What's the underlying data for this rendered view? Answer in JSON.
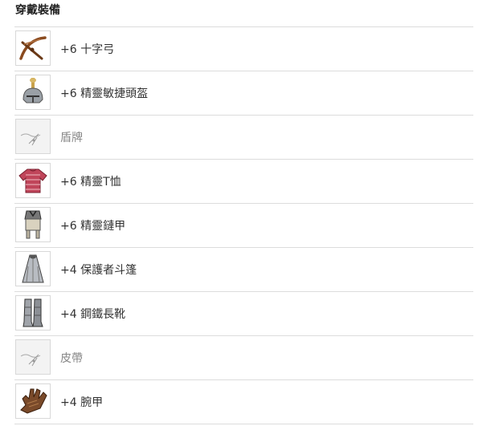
{
  "section": {
    "title": "穿戴裝備"
  },
  "items": [
    {
      "label": "+6 十字弓",
      "icon": "crossbow-icon",
      "empty": false
    },
    {
      "label": "+6 精靈敏捷頭盔",
      "icon": "helmet-icon",
      "empty": false
    },
    {
      "label": "盾牌",
      "icon": "empty-slot-icon",
      "empty": true
    },
    {
      "label": "+6 精靈T恤",
      "icon": "tshirt-icon",
      "empty": false
    },
    {
      "label": "+6 精靈鏈甲",
      "icon": "chainmail-icon",
      "empty": false
    },
    {
      "label": "+4 保護者斗篷",
      "icon": "cloak-icon",
      "empty": false
    },
    {
      "label": "+4 鋼鐵長靴",
      "icon": "boots-icon",
      "empty": false
    },
    {
      "label": "皮帶",
      "icon": "empty-slot-icon",
      "empty": true
    },
    {
      "label": "+4 腕甲",
      "icon": "gauntlet-icon",
      "empty": false
    }
  ]
}
